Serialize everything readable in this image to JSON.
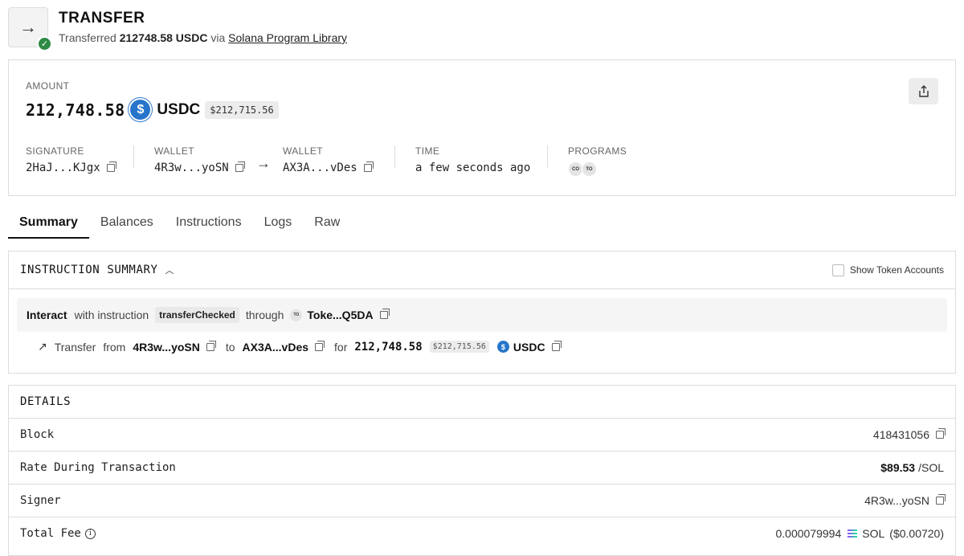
{
  "header": {
    "title": "TRANSFER",
    "sub_prefix": "Transferred",
    "sub_amount": "212748.58 USDC",
    "sub_via": "via",
    "sub_link": "Solana Program Library"
  },
  "amount_card": {
    "label": "AMOUNT",
    "value": "212,748.58",
    "token_symbol": "USDC",
    "usd_value": "$212,715.56",
    "token_icon": "usdc-logo-icon",
    "share_icon": "share-icon"
  },
  "meta": {
    "signature": {
      "label": "SIGNATURE",
      "value": "2HaJ...KJgx"
    },
    "wallet_from": {
      "label": "WALLET",
      "value": "4R3w...yoSN"
    },
    "wallet_to": {
      "label": "WALLET",
      "value": "AX3A...vDes"
    },
    "time": {
      "label": "TIME",
      "value": "a few seconds ago"
    },
    "programs": {
      "label": "PROGRAMS",
      "badges": [
        "CO",
        "TO"
      ]
    }
  },
  "tabs": [
    "Summary",
    "Balances",
    "Instructions",
    "Logs",
    "Raw"
  ],
  "active_tab": "Summary",
  "instruction_summary": {
    "title": "INSTRUCTION SUMMARY",
    "show_token_accounts": "Show Token Accounts",
    "interact": {
      "verb": "Interact",
      "with": "with instruction",
      "instruction": "transferChecked",
      "through": "through",
      "program_badge": "TO",
      "program": "Toke...Q5DA"
    },
    "transfer": {
      "verb": "Transfer",
      "from_word": "from",
      "from": "4R3w...yoSN",
      "to_word": "to",
      "to": "AX3A...vDes",
      "for_word": "for",
      "amount": "212,748.58",
      "usd": "$212,715.56",
      "symbol": "USDC"
    }
  },
  "details": {
    "title": "DETAILS",
    "rows": [
      {
        "key": "Block",
        "value": "418431056"
      },
      {
        "key": "Rate During Transaction",
        "value_bold": "$89.53",
        "value_suffix": "/SOL"
      },
      {
        "key": "Signer",
        "value": "4R3w...yoSN"
      },
      {
        "key": "Total Fee",
        "value": "0.000079994",
        "value_symbol": "SOL",
        "value_usd": "($0.00720)"
      }
    ]
  },
  "colors": {
    "usdc_blue": "#2775ca",
    "success_green": "#2e8a45",
    "border": "#dcdcdc"
  }
}
